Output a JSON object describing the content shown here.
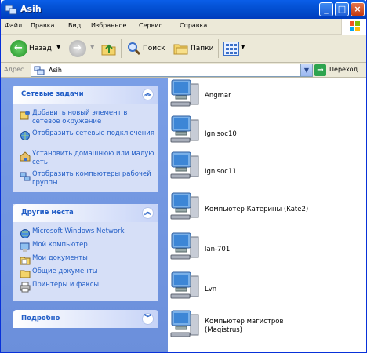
{
  "window": {
    "title": "Asih"
  },
  "menu": [
    "Файл",
    "Правка",
    "Вид",
    "Избранное",
    "Сервис",
    "Справка"
  ],
  "toolbar": {
    "back_label": "Назад",
    "search_label": "Поиск",
    "folders_label": "Папки"
  },
  "address": {
    "label": "Адрес",
    "value": "Asih",
    "go_label": "Переход"
  },
  "panels": {
    "network_tasks": {
      "title": "Сетевые задачи",
      "items": [
        "Добавить новый элемент в сетевое окружение",
        "Отобразить сетевые подключения",
        "Установить домашнюю или малую сеть",
        "Отобразить компьютеры рабочей группы"
      ]
    },
    "other_places": {
      "title": "Другие места",
      "items": [
        "Microsoft Windows Network",
        "Мой компьютер",
        "Мои документы",
        "Общие документы",
        "Принтеры и факсы"
      ]
    },
    "details": {
      "title": "Подробно"
    }
  },
  "computers": [
    "Angmar",
    "Ignisoc10",
    "Ignisoc11",
    "Компьютер Катерины (Kate2)",
    "lan-701",
    "Lvn",
    "Компьютер магистров (Magistrus)"
  ],
  "colors": {
    "title_bar": "#0554d9",
    "panel_bg": "#6b8fdb",
    "link": "#215dc6",
    "chrome": "#ece9d8"
  }
}
